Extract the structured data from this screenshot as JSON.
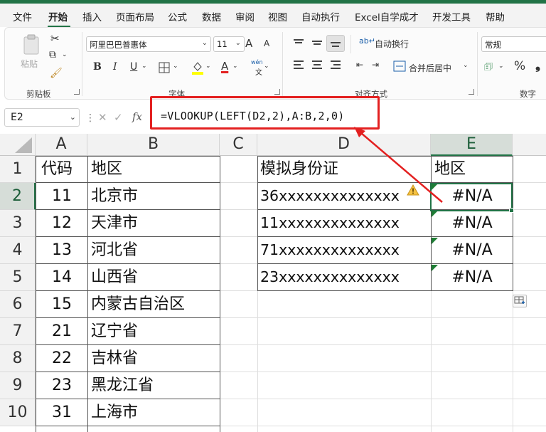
{
  "menu": {
    "tabs": [
      "文件",
      "开始",
      "插入",
      "页面布局",
      "公式",
      "数据",
      "审阅",
      "视图",
      "自动执行",
      "Excel自学成才",
      "开发工具",
      "帮助"
    ],
    "active": "开始"
  },
  "ribbon": {
    "clipboard": {
      "paste": "粘贴",
      "label": "剪贴板"
    },
    "font": {
      "name": "阿里巴巴普惠体",
      "size": "11",
      "grow": "A",
      "shrink": "A",
      "bold": "B",
      "italic": "I",
      "underline": "U",
      "font_color_glyph": "A",
      "wen": "wén",
      "label": "字体"
    },
    "alignment": {
      "wrap": "自动换行",
      "merge": "合并后居中",
      "label": "对齐方式"
    },
    "number": {
      "format": "常规",
      "percent": "%",
      "label": "数字"
    }
  },
  "formula_bar": {
    "name_box": "E2",
    "fx": "fx",
    "formula": "=VLOOKUP(LEFT(D2,2),A:B,2,0)"
  },
  "grid": {
    "columns": [
      "A",
      "B",
      "C",
      "D",
      "E"
    ],
    "selected_column": "E",
    "selected_row": "2",
    "rows": [
      "1",
      "2",
      "3",
      "4",
      "5",
      "6",
      "7",
      "8",
      "9",
      "10"
    ],
    "table_ab": {
      "header": [
        "代码",
        "地区"
      ],
      "rows": [
        [
          "11",
          "北京市"
        ],
        [
          "12",
          "天津市"
        ],
        [
          "13",
          "河北省"
        ],
        [
          "14",
          "山西省"
        ],
        [
          "15",
          "内蒙古自治区"
        ],
        [
          "21",
          "辽宁省"
        ],
        [
          "22",
          "吉林省"
        ],
        [
          "23",
          "黑龙江省"
        ],
        [
          "31",
          "上海市"
        ]
      ]
    },
    "table_de": {
      "header": [
        "模拟身份证",
        "地区"
      ],
      "rows": [
        [
          "36xxxxxxxxxxxxxx",
          "#N/A"
        ],
        [
          "11xxxxxxxxxxxxxx",
          "#N/A"
        ],
        [
          "71xxxxxxxxxxxxxx",
          "#N/A"
        ],
        [
          "23xxxxxxxxxxxxxx",
          "#N/A"
        ]
      ]
    }
  },
  "colors": {
    "accent": "#217346",
    "highlight": "#e32020",
    "error_triangle": "#1e7e34"
  }
}
